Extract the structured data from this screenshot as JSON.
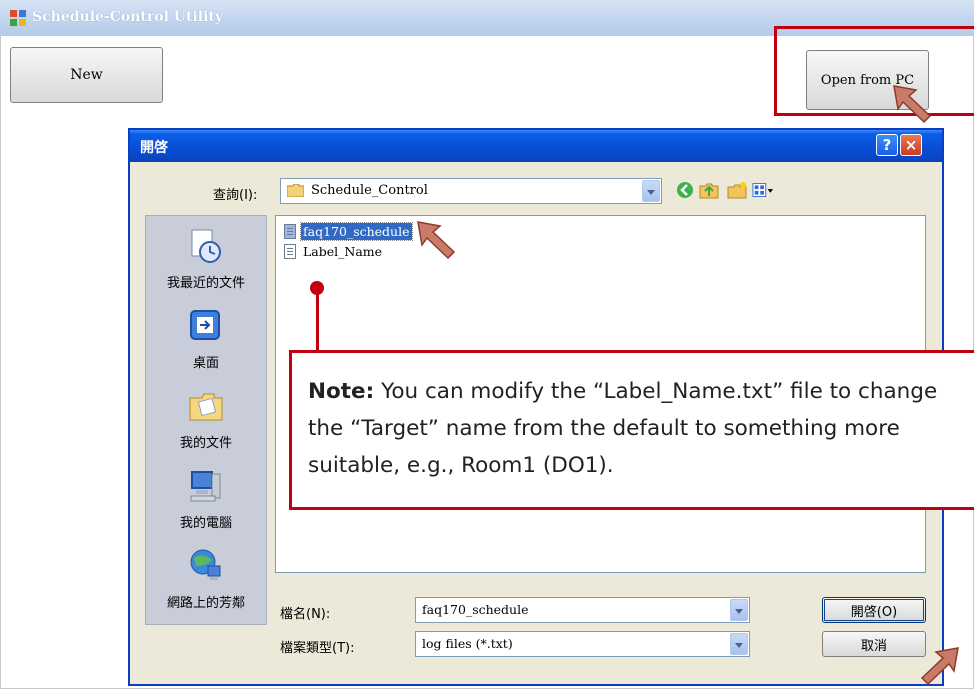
{
  "app": {
    "title": "Schedule-Control Utility",
    "new_button": "New",
    "open_from_pc_button": "Open from PC"
  },
  "dialog": {
    "title": "開啓",
    "look_in_label": "查詢(I):",
    "look_in_value": "Schedule_Control",
    "toolbar_icons": [
      "back-icon",
      "up-folder-icon",
      "new-folder-icon",
      "views-icon"
    ],
    "places": [
      {
        "label": "我最近的文件",
        "icon": "recent-documents-icon"
      },
      {
        "label": "桌面",
        "icon": "desktop-icon"
      },
      {
        "label": "我的文件",
        "icon": "my-documents-icon"
      },
      {
        "label": "我的電腦",
        "icon": "my-computer-icon"
      },
      {
        "label": "網路上的芳鄰",
        "icon": "network-places-icon"
      }
    ],
    "files": [
      {
        "name": "faq170_schedule",
        "selected": true
      },
      {
        "name": "Label_Name",
        "selected": false
      }
    ],
    "file_name_label": "檔名(N):",
    "file_name_value": "faq170_schedule",
    "file_type_label": "檔案類型(T):",
    "file_type_value": "log files (*.txt)",
    "open_button": "開啓(O)",
    "cancel_button": "取消",
    "help_button": "?",
    "close_button": "×"
  },
  "note": {
    "bold": "Note:",
    "text": " You can modify the “Label_Name.txt” file to change the “Target” name from the default to something more suitable, e.g., Room1 (DO1)."
  },
  "colors": {
    "highlight": "#c0000f",
    "dialog_title_bar": "#0a4fd8",
    "selection": "#316ac5"
  }
}
